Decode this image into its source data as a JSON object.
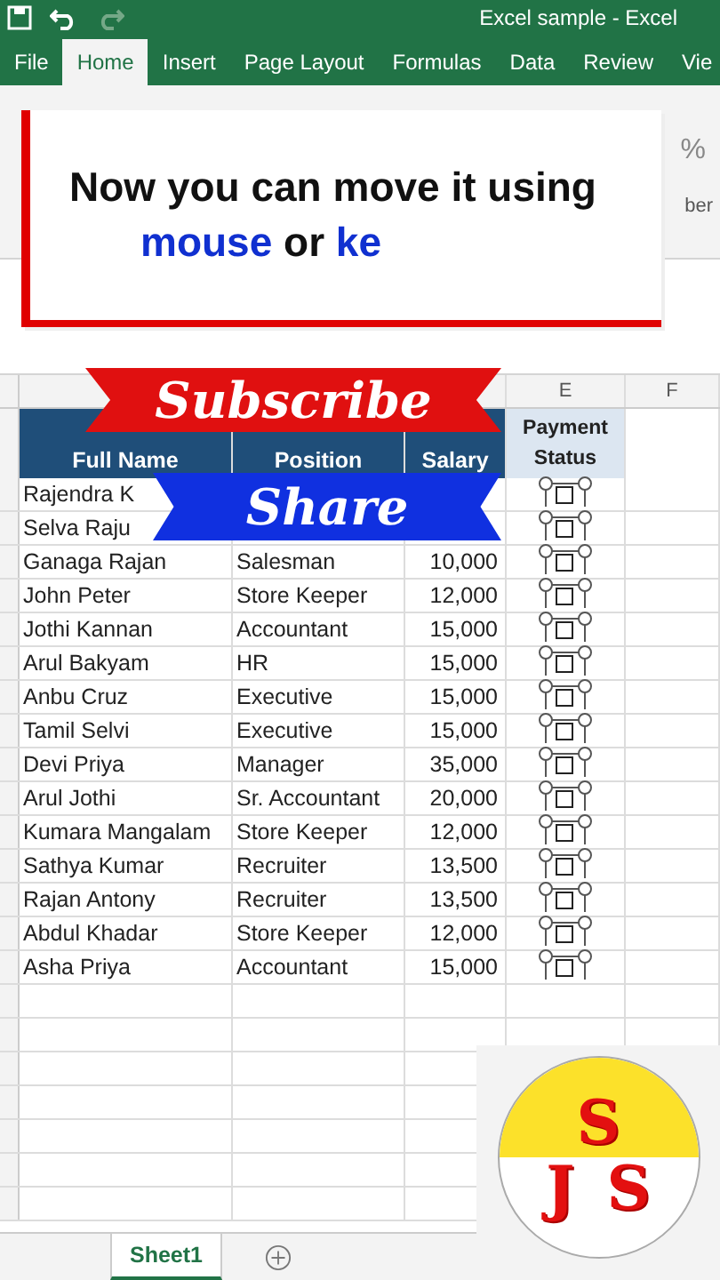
{
  "window": {
    "title": "Excel sample  -  Excel"
  },
  "ribbon_tabs": [
    {
      "label": "File",
      "selected": false
    },
    {
      "label": "Home",
      "selected": true
    },
    {
      "label": "Insert",
      "selected": false
    },
    {
      "label": "Page Layout",
      "selected": false
    },
    {
      "label": "Formulas",
      "selected": false
    },
    {
      "label": "Data",
      "selected": false
    },
    {
      "label": "Review",
      "selected": false
    },
    {
      "label": "Vie",
      "selected": false
    }
  ],
  "ribbon": {
    "percent_button": "%",
    "group_label": "ber"
  },
  "caption": {
    "lines": [
      [
        {
          "text": "Now you can move it using",
          "highlight": false
        }
      ],
      [
        {
          "text": "mouse",
          "highlight": true
        },
        {
          "text": "or",
          "highlight": false
        },
        {
          "text": "ke",
          "highlight": true
        }
      ]
    ]
  },
  "banners": [
    {
      "kind": "subscribe",
      "text": "Subscribe"
    },
    {
      "kind": "share",
      "text": "Share"
    }
  ],
  "column_letters": [
    "E",
    "F"
  ],
  "table": {
    "columns": [
      "Full Name",
      "Position",
      "Salary",
      "Payment Status"
    ],
    "rows": [
      {
        "name": "Rajendra K",
        "checked": false
      },
      {
        "name": "Selva Raju",
        "checked": false
      },
      {
        "name": "Ganaga Rajan",
        "position": "Salesman",
        "salary": "10,000",
        "checked": false
      },
      {
        "name": "John Peter",
        "position": "Store Keeper",
        "salary": "12,000",
        "checked": false
      },
      {
        "name": "Jothi Kannan",
        "position": "Accountant",
        "salary": "15,000",
        "checked": false
      },
      {
        "name": "Arul Bakyam",
        "position": "HR",
        "salary": "15,000",
        "checked": false
      },
      {
        "name": "Anbu Cruz",
        "position": "Executive",
        "salary": "15,000",
        "checked": false
      },
      {
        "name": "Tamil Selvi",
        "position": "Executive",
        "salary": "15,000",
        "checked": false
      },
      {
        "name": "Devi Priya",
        "position": "Manager",
        "salary": "35,000",
        "checked": false
      },
      {
        "name": "Arul Jothi",
        "position": "Sr. Accountant",
        "salary": "20,000",
        "checked": false
      },
      {
        "name": "Kumara Mangalam",
        "position": "Store Keeper",
        "salary": "12,000",
        "checked": false
      },
      {
        "name": "Sathya Kumar",
        "position": "Recruiter",
        "salary": "13,500",
        "checked": false
      },
      {
        "name": "Rajan Antony",
        "position": "Recruiter",
        "salary": "13,500",
        "checked": false
      },
      {
        "name": "Abdul Khadar",
        "position": "Store Keeper",
        "salary": "12,000",
        "checked": false
      },
      {
        "name": "Asha Priya",
        "position": "Accountant",
        "salary": "15,000",
        "checked": false
      }
    ]
  },
  "sheet_tabs": [
    {
      "label": "Sheet1",
      "selected": true
    }
  ],
  "logo": {
    "top": "S",
    "bottom": [
      "J",
      "S"
    ]
  }
}
